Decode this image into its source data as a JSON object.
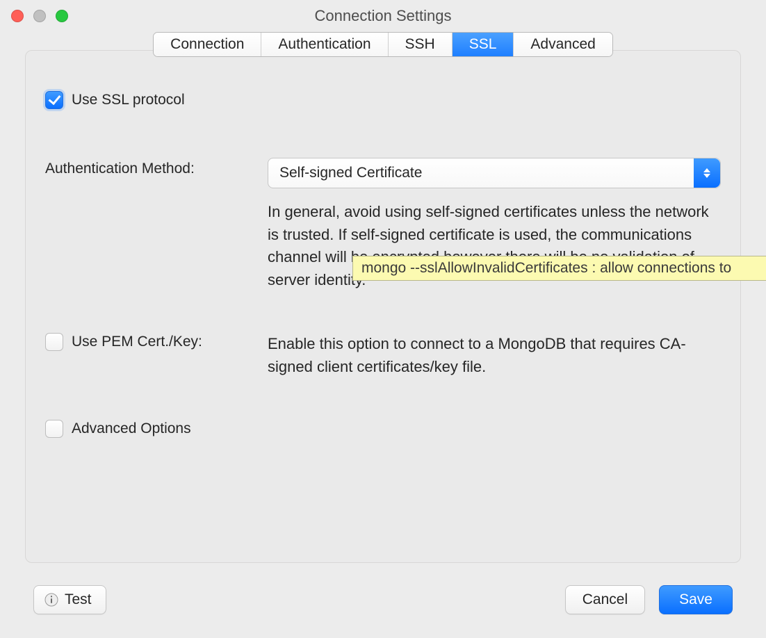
{
  "window": {
    "title": "Connection Settings"
  },
  "tabs": [
    {
      "label": "Connection"
    },
    {
      "label": "Authentication"
    },
    {
      "label": "SSH"
    },
    {
      "label": "SSL",
      "active": true
    },
    {
      "label": "Advanced"
    }
  ],
  "ssl": {
    "use_ssl_label": "Use SSL protocol",
    "use_ssl_checked": true,
    "auth_method_label": "Authentication Method:",
    "auth_method_value": "Self-signed Certificate",
    "auth_method_desc": "In general, avoid using self-signed certificates unless the network is trusted. If self-signed certificate is used, the communications channel will be encrypted however there will be no validation of server identity.",
    "tooltip": "mongo --sslAllowInvalidCertificates : allow connections to",
    "use_pem_label": "Use PEM Cert./Key:",
    "use_pem_checked": false,
    "use_pem_desc": "Enable this option to connect to a MongoDB that requires CA-signed client certificates/key file.",
    "advanced_label": "Advanced Options",
    "advanced_checked": false
  },
  "footer": {
    "test_label": "Test",
    "cancel_label": "Cancel",
    "save_label": "Save"
  }
}
